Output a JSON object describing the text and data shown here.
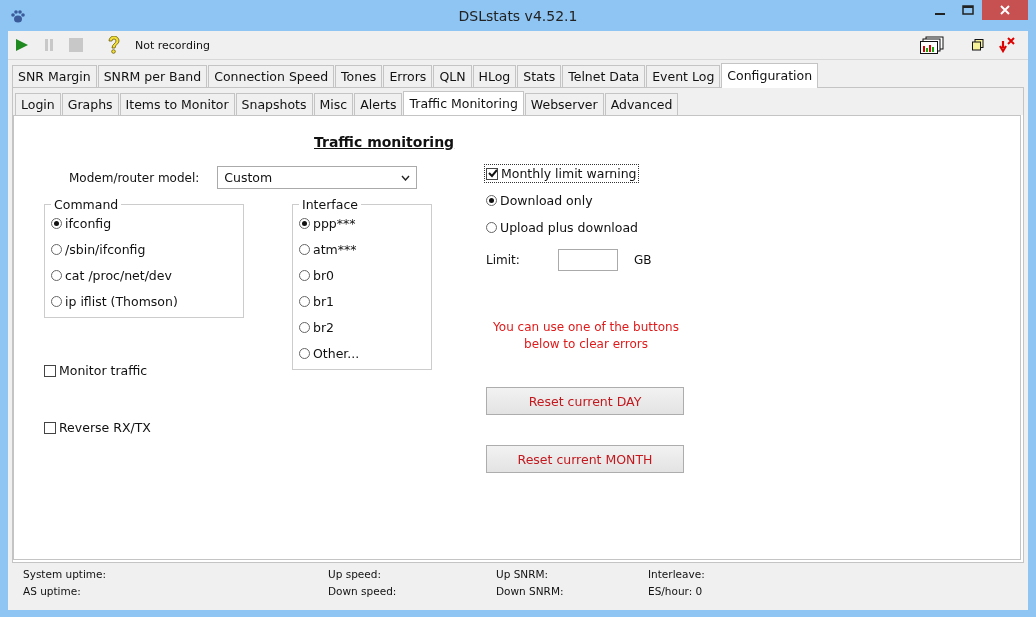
{
  "window": {
    "title": "DSLstats v4.52.1"
  },
  "toolbar": {
    "status": "Not recording"
  },
  "tabs": [
    {
      "label": "SNR Margin",
      "selected": false
    },
    {
      "label": "SNRM per Band",
      "selected": false
    },
    {
      "label": "Connection Speed",
      "selected": false
    },
    {
      "label": "Tones",
      "selected": false
    },
    {
      "label": "Errors",
      "selected": false
    },
    {
      "label": "QLN",
      "selected": false
    },
    {
      "label": "HLog",
      "selected": false
    },
    {
      "label": "Stats",
      "selected": false
    },
    {
      "label": "Telnet Data",
      "selected": false
    },
    {
      "label": "Event Log",
      "selected": false
    },
    {
      "label": "Configuration",
      "selected": true
    }
  ],
  "subtabs": [
    {
      "label": "Login",
      "selected": false
    },
    {
      "label": "Graphs",
      "selected": false
    },
    {
      "label": "Items to Monitor",
      "selected": false
    },
    {
      "label": "Snapshots",
      "selected": false
    },
    {
      "label": "Misc",
      "selected": false
    },
    {
      "label": "Alerts",
      "selected": false
    },
    {
      "label": "Traffic Monitoring",
      "selected": true
    },
    {
      "label": "Webserver",
      "selected": false
    },
    {
      "label": "Advanced",
      "selected": false
    }
  ],
  "panel": {
    "heading": "Traffic monitoring",
    "model": {
      "label": "Modem/router model:",
      "value": "Custom"
    },
    "command": {
      "legend": "Command",
      "options": [
        {
          "label": "ifconfig",
          "selected": true
        },
        {
          "label": "/sbin/ifconfig",
          "selected": false
        },
        {
          "label": "cat /proc/net/dev",
          "selected": false
        },
        {
          "label": "ip iflist (Thomson)",
          "selected": false
        }
      ]
    },
    "interface": {
      "legend": "Interface",
      "options": [
        {
          "label": "ppp***",
          "selected": true
        },
        {
          "label": "atm***",
          "selected": false
        },
        {
          "label": "br0",
          "selected": false
        },
        {
          "label": "br1",
          "selected": false
        },
        {
          "label": "br2",
          "selected": false
        },
        {
          "label": "Other...",
          "selected": false
        }
      ]
    },
    "monitor_traffic": {
      "label": "Monitor traffic",
      "checked": false
    },
    "reverse": {
      "label": "Reverse RX/TX",
      "checked": false
    },
    "monthly_warning": {
      "label": "Monthly limit warning",
      "checked": true
    },
    "limit_mode": [
      {
        "label": "Download only",
        "selected": true
      },
      {
        "label": "Upload plus download",
        "selected": false
      }
    ],
    "limit": {
      "label": "Limit:",
      "unit": "GB"
    },
    "message": "You can use one of the buttons below to clear errors",
    "buttons": [
      "Reset current DAY",
      "Reset current MONTH"
    ]
  },
  "status_bar": [
    [
      {
        "label": "System uptime:"
      },
      {
        "label": "AS uptime:"
      }
    ],
    [
      {
        "label": "Up speed:"
      },
      {
        "label": "Down speed:"
      }
    ],
    [
      {
        "label": "Up SNRM:"
      },
      {
        "label": "Down SNRM:"
      }
    ],
    [
      {
        "label": "Interleave:"
      },
      {
        "label": "ES/hour: 0"
      }
    ]
  ]
}
